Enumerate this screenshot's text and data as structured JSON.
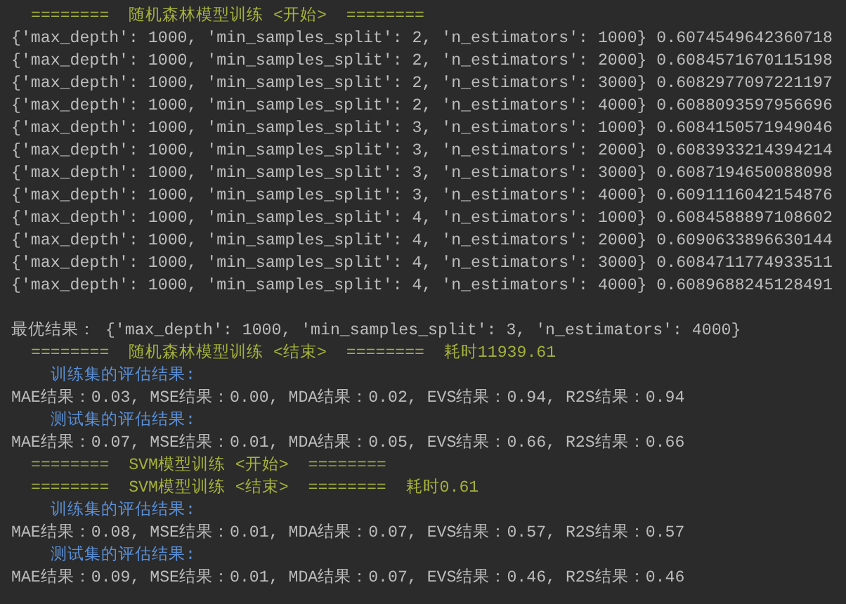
{
  "console": {
    "lines": [
      {
        "kind": "header",
        "text": "========  随机森林模型训练 <开始>  ========"
      },
      {
        "kind": "plain",
        "text": "{'max_depth': 1000, 'min_samples_split': 2, 'n_estimators': 1000} 0.6074549642360718"
      },
      {
        "kind": "plain",
        "text": "{'max_depth': 1000, 'min_samples_split': 2, 'n_estimators': 2000} 0.6084571670115198"
      },
      {
        "kind": "plain",
        "text": "{'max_depth': 1000, 'min_samples_split': 2, 'n_estimators': 3000} 0.6082977097221197"
      },
      {
        "kind": "plain",
        "text": "{'max_depth': 1000, 'min_samples_split': 2, 'n_estimators': 4000} 0.6088093597956696"
      },
      {
        "kind": "plain",
        "text": "{'max_depth': 1000, 'min_samples_split': 3, 'n_estimators': 1000} 0.6084150571949046"
      },
      {
        "kind": "plain",
        "text": "{'max_depth': 1000, 'min_samples_split': 3, 'n_estimators': 2000} 0.6083933214394214"
      },
      {
        "kind": "plain",
        "text": "{'max_depth': 1000, 'min_samples_split': 3, 'n_estimators': 3000} 0.6087194650088098"
      },
      {
        "kind": "plain",
        "text": "{'max_depth': 1000, 'min_samples_split': 3, 'n_estimators': 4000} 0.6091116042154876"
      },
      {
        "kind": "plain",
        "text": "{'max_depth': 1000, 'min_samples_split': 4, 'n_estimators': 1000} 0.6084588897108602"
      },
      {
        "kind": "plain",
        "text": "{'max_depth': 1000, 'min_samples_split': 4, 'n_estimators': 2000} 0.6090633896630144"
      },
      {
        "kind": "plain",
        "text": "{'max_depth': 1000, 'min_samples_split': 4, 'n_estimators': 3000} 0.6084711774933511"
      },
      {
        "kind": "plain",
        "text": "{'max_depth': 1000, 'min_samples_split': 4, 'n_estimators': 4000} 0.6089688245128491"
      },
      {
        "kind": "blank"
      },
      {
        "kind": "plain",
        "text": "最优结果： {'max_depth': 1000, 'min_samples_split': 3, 'n_estimators': 4000}"
      },
      {
        "kind": "header",
        "text": "========  随机森林模型训练 <结束>  ========  耗时11939.61"
      },
      {
        "kind": "section",
        "text": "训练集的评估结果:"
      },
      {
        "kind": "plain",
        "text": "MAE结果：0.03, MSE结果：0.00, MDA结果：0.02, EVS结果：0.94, R2S结果：0.94"
      },
      {
        "kind": "section",
        "text": "测试集的评估结果:"
      },
      {
        "kind": "plain",
        "text": "MAE结果：0.07, MSE结果：0.01, MDA结果：0.05, EVS结果：0.66, R2S结果：0.66"
      },
      {
        "kind": "header",
        "text": "========  SVM模型训练 <开始>  ========"
      },
      {
        "kind": "header",
        "text": "========  SVM模型训练 <结束>  ========  耗时0.61"
      },
      {
        "kind": "section",
        "text": "训练集的评估结果:"
      },
      {
        "kind": "plain",
        "text": "MAE结果：0.08, MSE结果：0.01, MDA结果：0.07, EVS结果：0.57, R2S结果：0.57"
      },
      {
        "kind": "section",
        "text": "测试集的评估结果:"
      },
      {
        "kind": "plain",
        "text": "MAE结果：0.09, MSE结果：0.01, MDA结果：0.07, EVS结果：0.46, R2S结果：0.46"
      }
    ]
  }
}
